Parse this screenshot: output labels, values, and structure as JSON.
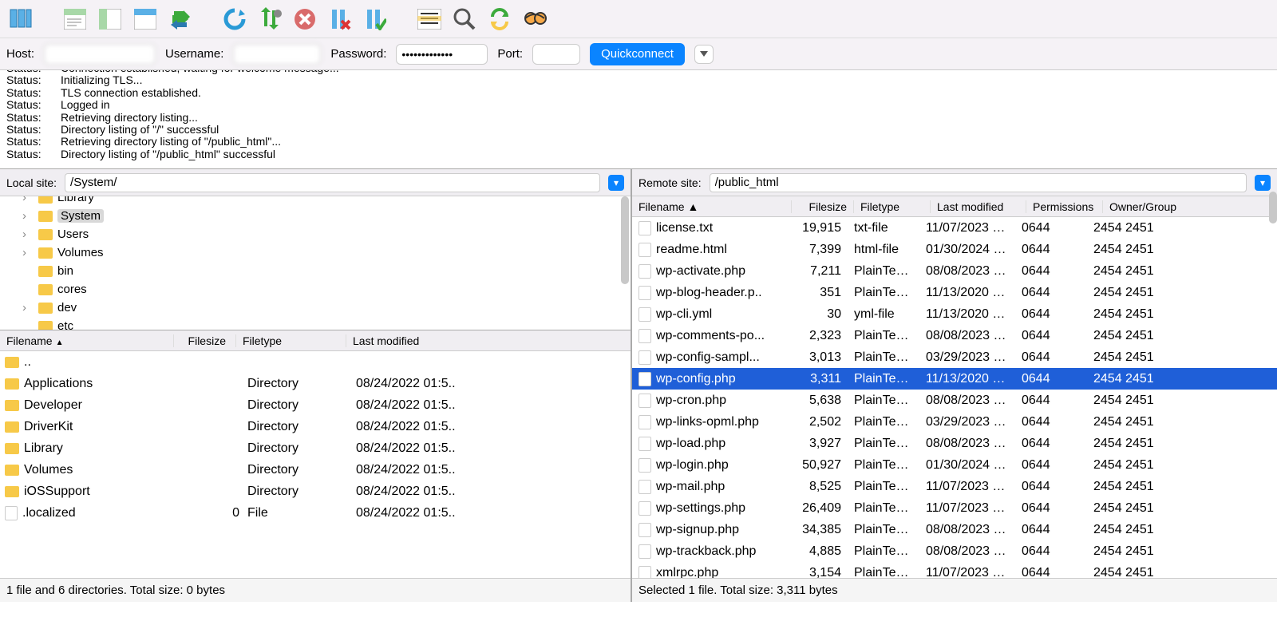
{
  "conn": {
    "host_label": "Host:",
    "user_label": "Username:",
    "pass_label": "Password:",
    "port_label": "Port:",
    "password_mask": "•••••••••••••",
    "quickconnect": "Quickconnect"
  },
  "log": [
    {
      "label": "Status:",
      "msg": "Connection established, waiting for welcome message..."
    },
    {
      "label": "Status:",
      "msg": "Initializing TLS..."
    },
    {
      "label": "Status:",
      "msg": "TLS connection established."
    },
    {
      "label": "Status:",
      "msg": "Logged in"
    },
    {
      "label": "Status:",
      "msg": "Retrieving directory listing..."
    },
    {
      "label": "Status:",
      "msg": "Directory listing of \"/\" successful"
    },
    {
      "label": "Status:",
      "msg": "Retrieving directory listing of \"/public_html\"..."
    },
    {
      "label": "Status:",
      "msg": "Directory listing of \"/public_html\" successful"
    }
  ],
  "local": {
    "site_label": "Local site:",
    "path": "/System/",
    "tree": [
      {
        "name": "Library",
        "expand": true,
        "cut": true
      },
      {
        "name": "System",
        "expand": true,
        "selected": true
      },
      {
        "name": "Users",
        "expand": true
      },
      {
        "name": "Volumes",
        "expand": true
      },
      {
        "name": "bin",
        "expand": false
      },
      {
        "name": "cores",
        "expand": false
      },
      {
        "name": "dev",
        "expand": true
      },
      {
        "name": "etc",
        "expand": false
      }
    ],
    "headers": {
      "name": "Filename",
      "size": "Filesize",
      "type": "Filetype",
      "mod": "Last modified"
    },
    "files": [
      {
        "name": "..",
        "size": "",
        "type": "",
        "mod": "",
        "folder": true
      },
      {
        "name": "Applications",
        "size": "",
        "type": "Directory",
        "mod": "08/24/2022 01:5..",
        "folder": true
      },
      {
        "name": "Developer",
        "size": "",
        "type": "Directory",
        "mod": "08/24/2022 01:5..",
        "folder": true
      },
      {
        "name": "DriverKit",
        "size": "",
        "type": "Directory",
        "mod": "08/24/2022 01:5..",
        "folder": true
      },
      {
        "name": "Library",
        "size": "",
        "type": "Directory",
        "mod": "08/24/2022 01:5..",
        "folder": true
      },
      {
        "name": "Volumes",
        "size": "",
        "type": "Directory",
        "mod": "08/24/2022 01:5..",
        "folder": true
      },
      {
        "name": "iOSSupport",
        "size": "",
        "type": "Directory",
        "mod": "08/24/2022 01:5..",
        "folder": true
      },
      {
        "name": ".localized",
        "size": "0",
        "type": "File",
        "mod": "08/24/2022 01:5..",
        "folder": false
      }
    ],
    "status": "1 file and 6 directories. Total size: 0 bytes"
  },
  "remote": {
    "site_label": "Remote site:",
    "path": "/public_html",
    "headers": {
      "name": "Filename",
      "size": "Filesize",
      "type": "Filetype",
      "mod": "Last modified",
      "perm": "Permissions",
      "own": "Owner/Group"
    },
    "files": [
      {
        "name": "license.txt",
        "size": "19,915",
        "type": "txt-file",
        "mod": "11/07/2023 1...",
        "perm": "0644",
        "own": "2454 2451"
      },
      {
        "name": "readme.html",
        "size": "7,399",
        "type": "html-file",
        "mod": "01/30/2024 1...",
        "perm": "0644",
        "own": "2454 2451"
      },
      {
        "name": "wp-activate.php",
        "size": "7,211",
        "type": "PlainTextT..",
        "mod": "08/08/2023 1...",
        "perm": "0644",
        "own": "2454 2451"
      },
      {
        "name": "wp-blog-header.p..",
        "size": "351",
        "type": "PlainTextT..",
        "mod": "11/13/2020 0...",
        "perm": "0644",
        "own": "2454 2451"
      },
      {
        "name": "wp-cli.yml",
        "size": "30",
        "type": "yml-file",
        "mod": "11/13/2020 0...",
        "perm": "0644",
        "own": "2454 2451"
      },
      {
        "name": "wp-comments-po...",
        "size": "2,323",
        "type": "PlainTextT..",
        "mod": "08/08/2023 1...",
        "perm": "0644",
        "own": "2454 2451"
      },
      {
        "name": "wp-config-sampl...",
        "size": "3,013",
        "type": "PlainTextT..",
        "mod": "03/29/2023 1...",
        "perm": "0644",
        "own": "2454 2451"
      },
      {
        "name": "wp-config.php",
        "size": "3,311",
        "type": "PlainTextT..",
        "mod": "11/13/2020 0...",
        "perm": "0644",
        "own": "2454 2451",
        "selected": true
      },
      {
        "name": "wp-cron.php",
        "size": "5,638",
        "type": "PlainTextT..",
        "mod": "08/08/2023 1...",
        "perm": "0644",
        "own": "2454 2451"
      },
      {
        "name": "wp-links-opml.php",
        "size": "2,502",
        "type": "PlainTextT..",
        "mod": "03/29/2023 1...",
        "perm": "0644",
        "own": "2454 2451"
      },
      {
        "name": "wp-load.php",
        "size": "3,927",
        "type": "PlainTextT..",
        "mod": "08/08/2023 1...",
        "perm": "0644",
        "own": "2454 2451"
      },
      {
        "name": "wp-login.php",
        "size": "50,927",
        "type": "PlainTextT..",
        "mod": "01/30/2024 1...",
        "perm": "0644",
        "own": "2454 2451"
      },
      {
        "name": "wp-mail.php",
        "size": "8,525",
        "type": "PlainTextT..",
        "mod": "11/07/2023 1...",
        "perm": "0644",
        "own": "2454 2451"
      },
      {
        "name": "wp-settings.php",
        "size": "26,409",
        "type": "PlainTextT..",
        "mod": "11/07/2023 1...",
        "perm": "0644",
        "own": "2454 2451"
      },
      {
        "name": "wp-signup.php",
        "size": "34,385",
        "type": "PlainTextT..",
        "mod": "08/08/2023 1...",
        "perm": "0644",
        "own": "2454 2451"
      },
      {
        "name": "wp-trackback.php",
        "size": "4,885",
        "type": "PlainTextT..",
        "mod": "08/08/2023 1...",
        "perm": "0644",
        "own": "2454 2451"
      },
      {
        "name": "xmlrpc.php",
        "size": "3,154",
        "type": "PlainTextT..",
        "mod": "11/07/2023 1...",
        "perm": "0644",
        "own": "2454 2451"
      }
    ],
    "status": "Selected 1 file. Total size: 3,311 bytes"
  }
}
